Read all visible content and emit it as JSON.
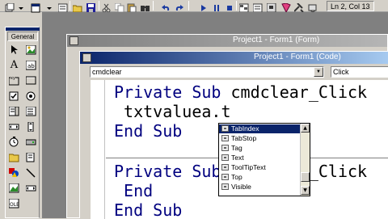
{
  "toolbar": {
    "cursor_position": "Ln 2, Col 13",
    "icons": [
      "add-project-icon",
      "add-form-icon",
      "menu-editor-icon",
      "open-icon",
      "save-icon",
      "cut-icon",
      "copy-icon",
      "paste-icon",
      "find-icon",
      "undo-icon",
      "redo-icon",
      "run-icon",
      "pause-icon",
      "stop-icon",
      "project-explorer-icon",
      "properties-icon",
      "form-layout-icon",
      "object-browser-icon",
      "toolbox-icon"
    ]
  },
  "toolbox": {
    "label": "General",
    "tools": [
      "pointer",
      "picture-box",
      "label",
      "textbox",
      "frame",
      "command-button",
      "checkbox",
      "option-button",
      "combobox",
      "listbox",
      "hscroll",
      "vscroll",
      "timer",
      "drive-list",
      "dir-list",
      "file-list",
      "shape",
      "line",
      "image",
      "data",
      "ole"
    ]
  },
  "form_window": {
    "title": "Project1 - Form1 (Form)"
  },
  "code_window": {
    "title": "Project1 - Form1 (Code)",
    "object_combo": "cmdclear",
    "procedure_combo": "Click",
    "lines": [
      {
        "kw": "Private Sub ",
        "text": "cmdclear_Click"
      },
      {
        "kw": "",
        "text": " txtvaluea.t"
      },
      {
        "kw": "End Sub",
        "text": ""
      },
      {
        "kw": "",
        "text": ""
      },
      {
        "kw": "Private Sub ",
        "text": "cmdclose_Click"
      },
      {
        "kw": " End",
        "text": ""
      },
      {
        "kw": "End Sub",
        "text": ""
      }
    ]
  },
  "intellisense": {
    "items": [
      "TabIndex",
      "TabStop",
      "Tag",
      "Text",
      "ToolTipText",
      "Top",
      "Visible"
    ],
    "selected": "TabIndex"
  }
}
